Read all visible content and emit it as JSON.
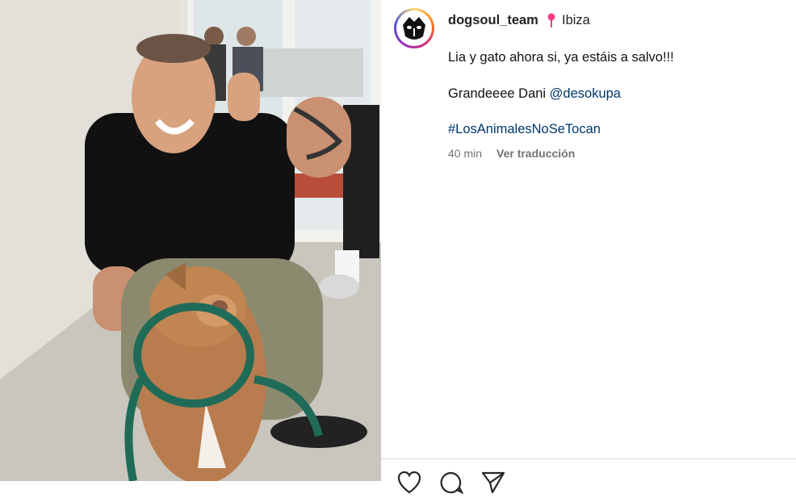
{
  "post": {
    "username": "dogsoul_team",
    "location": "Ibiza",
    "caption_line1": "Lia y gato ahora si, ya estáis a salvo!!!",
    "caption_line2_text": "Grandeeee Dani ",
    "caption_line2_mention": "@desokupa",
    "hashtag": "#LosAnimalesNoSeTocan",
    "time_ago": "40 min",
    "translate_label": "Ver traducción"
  },
  "icons": {
    "avatar": "dog-cat-logo-avatar",
    "location": "pin-icon",
    "like": "heart-icon",
    "comment": "comment-icon",
    "share": "send-icon"
  },
  "colors": {
    "link": "#00376b",
    "meta": "#737373",
    "pin": "#ff3e86"
  }
}
